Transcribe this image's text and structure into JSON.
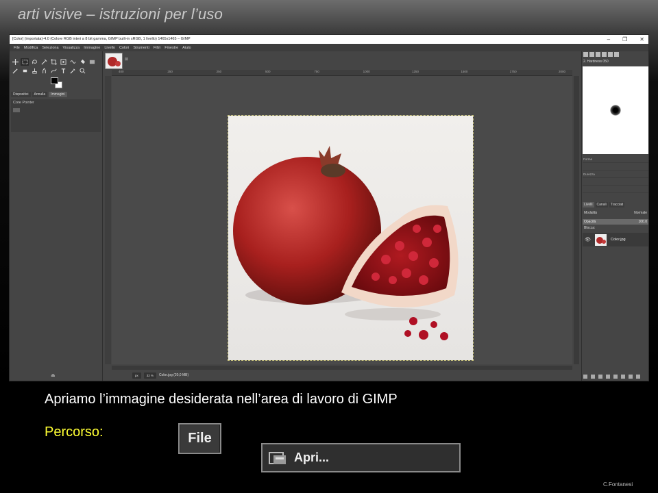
{
  "slide": {
    "title": "arti visive – istruzioni per l’uso",
    "caption": "Apriamo l’immagine desiderata nell’area di lavoro di GIMP",
    "path_label": "Percorso:",
    "file_label": "File",
    "apri_label": "Apri...",
    "credit": "C.Fontanesi"
  },
  "gimp": {
    "window_title": "[Color] (importata)-4.0 (Colore RGB interi a 8 bit gamma, GIMP built-in sRGB, 1 livello) 1465x1465 – GIMP",
    "menu": [
      "File",
      "Modifica",
      "Seleziona",
      "Visualizza",
      "Immagine",
      "Livello",
      "Colori",
      "Strumenti",
      "Filtri",
      "Finestre",
      "Aiuto"
    ],
    "left_dock": {
      "tabs": [
        "Dispositivi",
        "Annulla",
        "Immagini"
      ],
      "panel_title": "Core Pointer"
    },
    "ruler_ticks": [
      "400",
      "250",
      "250",
      "500",
      "750",
      "1000",
      "1250",
      "1500",
      "1750",
      "2000"
    ],
    "status": {
      "unit": "px",
      "zoom": "32 %",
      "file_info": "Color.jpg (20,0 MB)"
    },
    "right_dock": {
      "brush_name": "2. Hardness 050",
      "brush_options": [
        "Forma",
        "",
        "Durezza",
        "",
        ""
      ],
      "layers_tabs": [
        "Livelli",
        "Canali",
        "Tracciati"
      ],
      "mode_label": "Modalità",
      "mode_value": "Normale",
      "opacity_label": "Opacità",
      "opacity_value": "100.0",
      "lock_label": "Blocca:",
      "layer_name": "Color.jpg"
    },
    "colors": {
      "fg": "#000000",
      "bg": "#ffffff"
    }
  }
}
